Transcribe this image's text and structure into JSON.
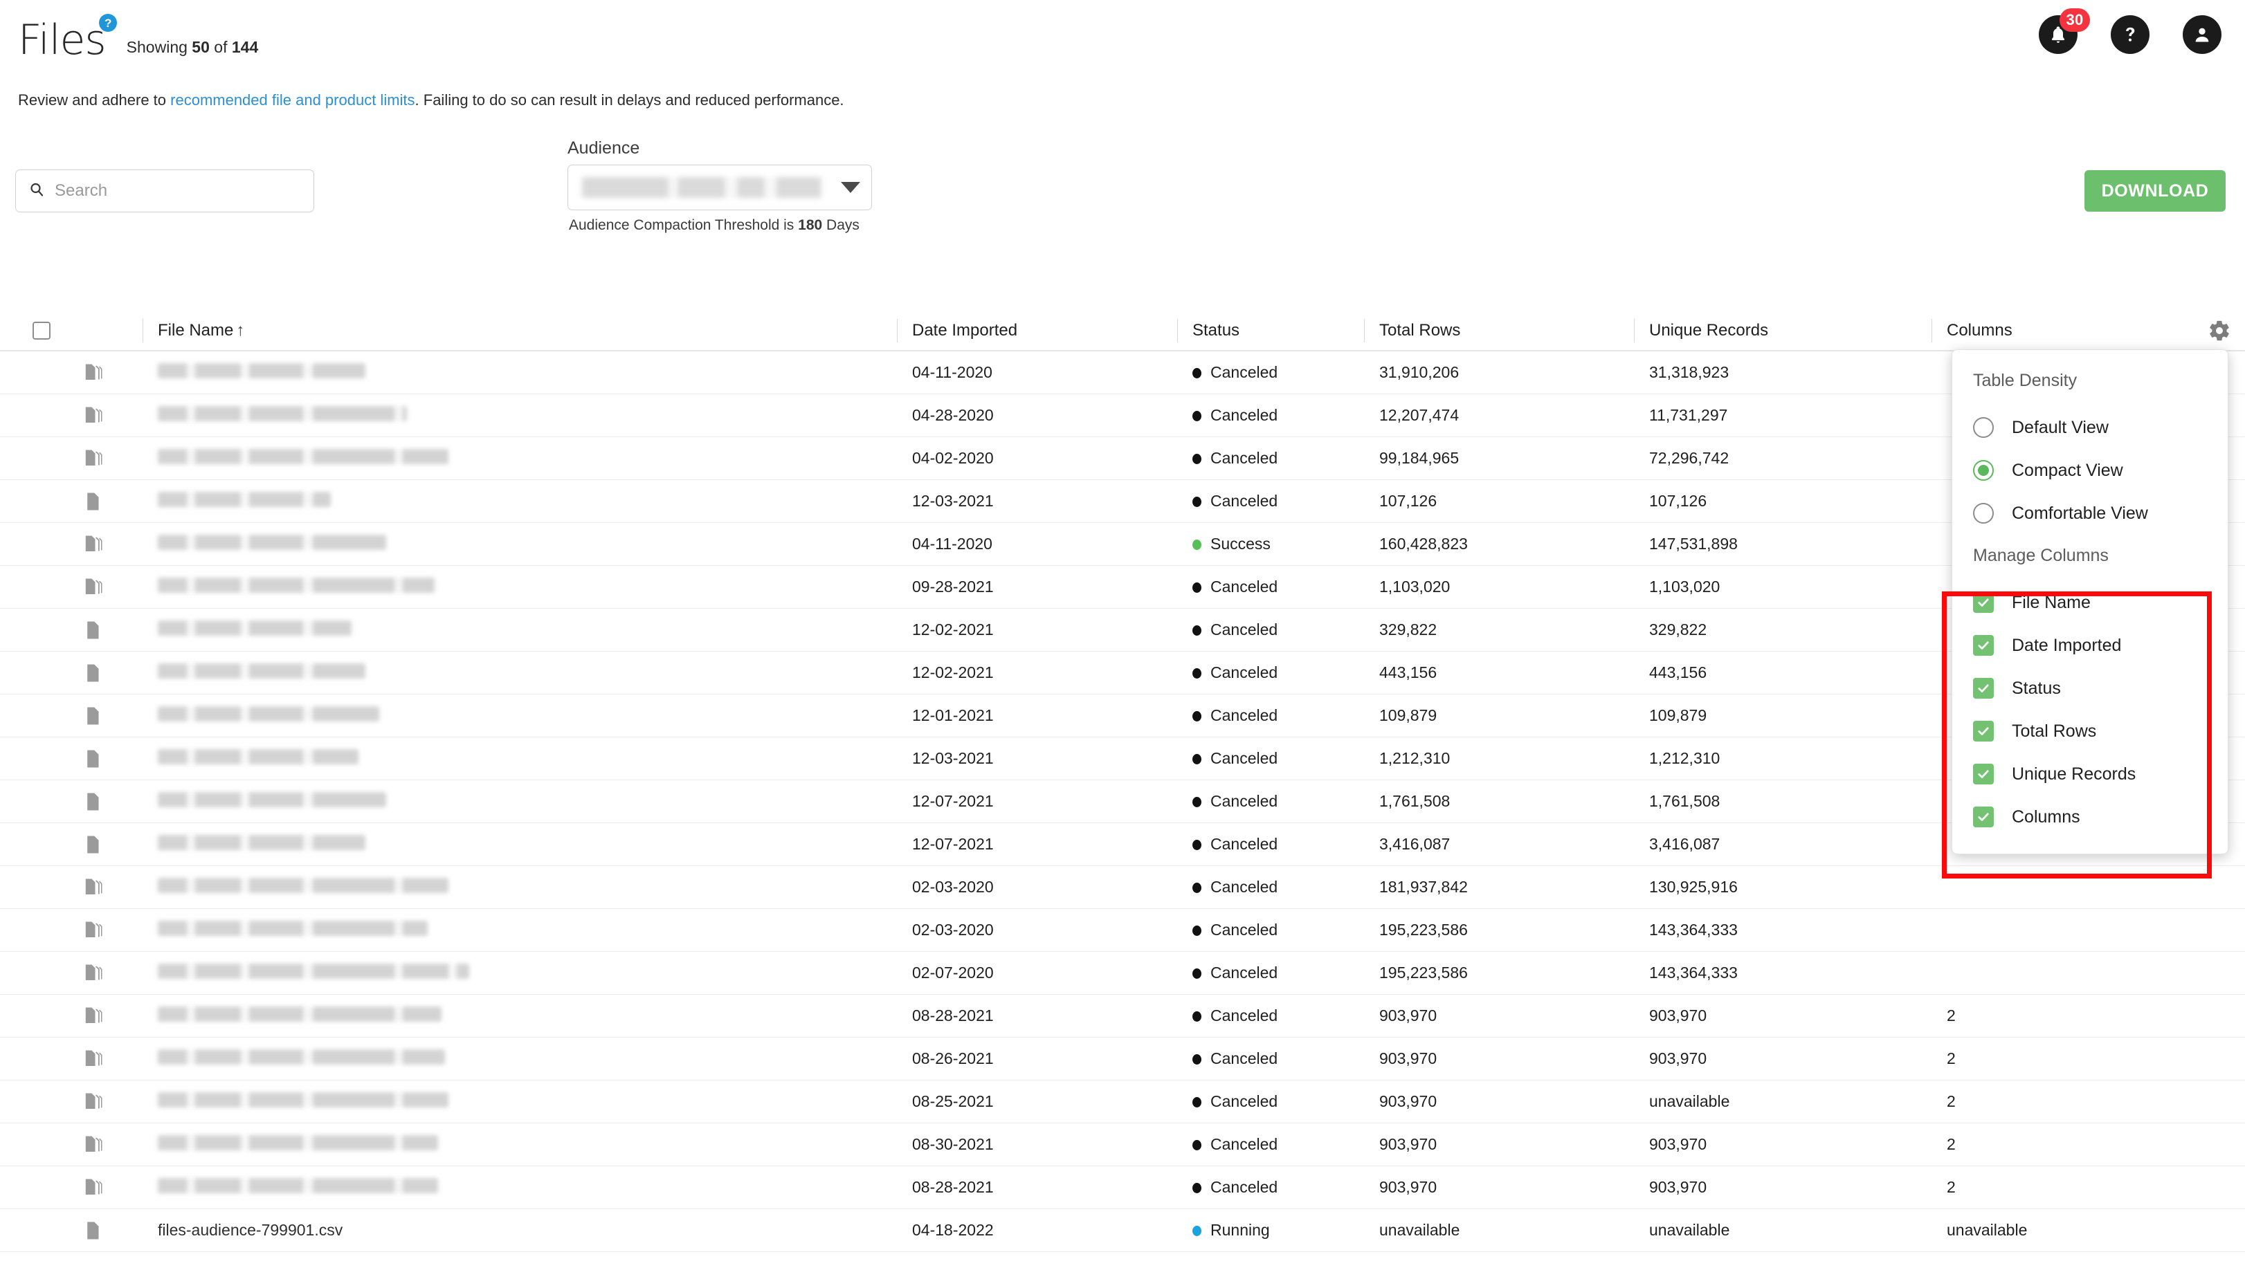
{
  "header": {
    "app_title": "Files",
    "help_badge": "?",
    "showing_prefix": "Showing ",
    "showing_count": "50",
    "showing_mid": " of ",
    "showing_total": "144",
    "subtitle_before": "Review and adhere to ",
    "subtitle_link": "recommended file and product limits",
    "subtitle_after": ". Failing to do so can result in delays and reduced performance."
  },
  "topbar": {
    "notifications_count": "30",
    "notifications_icon": "bell-icon",
    "help_icon": "question-mark-icon",
    "account_icon": "user-avatar-icon"
  },
  "controls": {
    "search_placeholder": "Search",
    "search_value": "",
    "search_icon": "search-icon",
    "audience_label": "Audience",
    "audience_value": "",
    "audience_note_before": "Audience Compaction Threshold is ",
    "audience_note_value": "180",
    "audience_note_after": " Days",
    "download_label": "DOWNLOAD"
  },
  "table": {
    "columns": [
      "File Name",
      "Date Imported",
      "Status",
      "Total Rows",
      "Unique Records",
      "Columns"
    ],
    "sort_column": "File Name",
    "sort_direction": "↑",
    "gear_icon": "gear-icon",
    "rows": [
      {
        "icon": "multi-file-icon",
        "name": "",
        "date": "04-11-2020",
        "status": "Canceled",
        "status_color": "#111111",
        "total_rows": "31,910,206",
        "unique_records": "31,318,923",
        "cols": ""
      },
      {
        "icon": "multi-file-icon",
        "name": "",
        "date": "04-28-2020",
        "status": "Canceled",
        "status_color": "#111111",
        "total_rows": "12,207,474",
        "unique_records": "11,731,297",
        "cols": ""
      },
      {
        "icon": "multi-file-icon",
        "name": "",
        "date": "04-02-2020",
        "status": "Canceled",
        "status_color": "#111111",
        "total_rows": "99,184,965",
        "unique_records": "72,296,742",
        "cols": ""
      },
      {
        "icon": "single-file-icon",
        "name": "",
        "date": "12-03-2021",
        "status": "Canceled",
        "status_color": "#111111",
        "total_rows": "107,126",
        "unique_records": "107,126",
        "cols": ""
      },
      {
        "icon": "multi-file-icon",
        "name": "",
        "date": "04-11-2020",
        "status": "Success",
        "status_color": "#55c055",
        "total_rows": "160,428,823",
        "unique_records": "147,531,898",
        "cols": ""
      },
      {
        "icon": "multi-file-icon",
        "name": "",
        "date": "09-28-2021",
        "status": "Canceled",
        "status_color": "#111111",
        "total_rows": "1,103,020",
        "unique_records": "1,103,020",
        "cols": ""
      },
      {
        "icon": "single-file-icon",
        "name": "",
        "date": "12-02-2021",
        "status": "Canceled",
        "status_color": "#111111",
        "total_rows": "329,822",
        "unique_records": "329,822",
        "cols": ""
      },
      {
        "icon": "single-file-icon",
        "name": "",
        "date": "12-02-2021",
        "status": "Canceled",
        "status_color": "#111111",
        "total_rows": "443,156",
        "unique_records": "443,156",
        "cols": ""
      },
      {
        "icon": "single-file-icon",
        "name": "",
        "date": "12-01-2021",
        "status": "Canceled",
        "status_color": "#111111",
        "total_rows": "109,879",
        "unique_records": "109,879",
        "cols": ""
      },
      {
        "icon": "single-file-icon",
        "name": "",
        "date": "12-03-2021",
        "status": "Canceled",
        "status_color": "#111111",
        "total_rows": "1,212,310",
        "unique_records": "1,212,310",
        "cols": ""
      },
      {
        "icon": "single-file-icon",
        "name": "",
        "date": "12-07-2021",
        "status": "Canceled",
        "status_color": "#111111",
        "total_rows": "1,761,508",
        "unique_records": "1,761,508",
        "cols": ""
      },
      {
        "icon": "single-file-icon",
        "name": "",
        "date": "12-07-2021",
        "status": "Canceled",
        "status_color": "#111111",
        "total_rows": "3,416,087",
        "unique_records": "3,416,087",
        "cols": ""
      },
      {
        "icon": "multi-file-icon",
        "name": "",
        "date": "02-03-2020",
        "status": "Canceled",
        "status_color": "#111111",
        "total_rows": "181,937,842",
        "unique_records": "130,925,916",
        "cols": ""
      },
      {
        "icon": "multi-file-icon",
        "name": "",
        "date": "02-03-2020",
        "status": "Canceled",
        "status_color": "#111111",
        "total_rows": "195,223,586",
        "unique_records": "143,364,333",
        "cols": ""
      },
      {
        "icon": "multi-file-icon",
        "name": "",
        "date": "02-07-2020",
        "status": "Canceled",
        "status_color": "#111111",
        "total_rows": "195,223,586",
        "unique_records": "143,364,333",
        "cols": ""
      },
      {
        "icon": "multi-file-icon",
        "name": "",
        "date": "08-28-2021",
        "status": "Canceled",
        "status_color": "#111111",
        "total_rows": "903,970",
        "unique_records": "903,970",
        "cols": "2"
      },
      {
        "icon": "multi-file-icon",
        "name": "",
        "date": "08-26-2021",
        "status": "Canceled",
        "status_color": "#111111",
        "total_rows": "903,970",
        "unique_records": "903,970",
        "cols": "2"
      },
      {
        "icon": "multi-file-icon",
        "name": "",
        "date": "08-25-2021",
        "status": "Canceled",
        "status_color": "#111111",
        "total_rows": "903,970",
        "unique_records": "unavailable",
        "cols": "2"
      },
      {
        "icon": "multi-file-icon",
        "name": "",
        "date": "08-30-2021",
        "status": "Canceled",
        "status_color": "#111111",
        "total_rows": "903,970",
        "unique_records": "903,970",
        "cols": "2"
      },
      {
        "icon": "multi-file-icon",
        "name": "",
        "date": "08-28-2021",
        "status": "Canceled",
        "status_color": "#111111",
        "total_rows": "903,970",
        "unique_records": "903,970",
        "cols": "2"
      },
      {
        "icon": "single-file-icon",
        "name": "files-audience-799901.csv",
        "date": "04-18-2022",
        "status": "Running",
        "status_color": "#1ba3e0",
        "total_rows": "unavailable",
        "unique_records": "unavailable",
        "cols": "unavailable"
      }
    ]
  },
  "settings_popover": {
    "density_heading": "Table Density",
    "density_options": [
      {
        "label": "Default View",
        "selected": false
      },
      {
        "label": "Compact View",
        "selected": true
      },
      {
        "label": "Comfortable View",
        "selected": false
      }
    ],
    "manage_heading": "Manage Columns",
    "manage_options": [
      {
        "label": "File Name",
        "checked": true
      },
      {
        "label": "Date Imported",
        "checked": true
      },
      {
        "label": "Status",
        "checked": true
      },
      {
        "label": "Total Rows",
        "checked": true
      },
      {
        "label": "Unique Records",
        "checked": true
      },
      {
        "label": "Columns",
        "checked": true
      }
    ]
  },
  "annotation": {
    "highlight_color": "#fa0b0b"
  }
}
